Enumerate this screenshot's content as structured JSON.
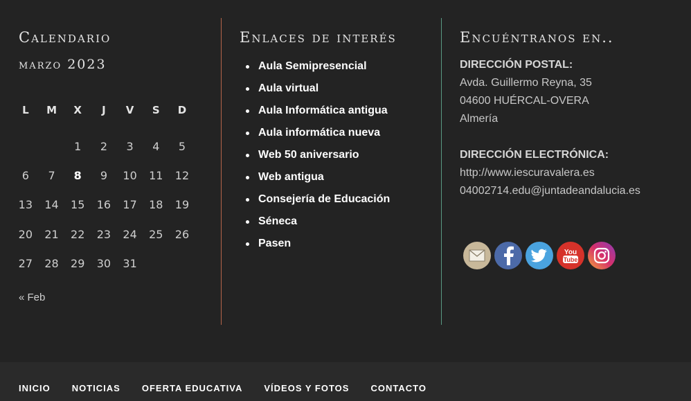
{
  "calendar": {
    "title": "Calendario",
    "month_caption": "marzo 2023",
    "weekdays": [
      "L",
      "M",
      "X",
      "J",
      "V",
      "S",
      "D"
    ],
    "weeks": [
      [
        "",
        "",
        "1",
        "2",
        "3",
        "4",
        "5"
      ],
      [
        "6",
        "7",
        "8",
        "9",
        "10",
        "11",
        "12"
      ],
      [
        "13",
        "14",
        "15",
        "16",
        "17",
        "18",
        "19"
      ],
      [
        "20",
        "21",
        "22",
        "23",
        "24",
        "25",
        "26"
      ],
      [
        "27",
        "28",
        "29",
        "30",
        "31",
        "",
        ""
      ]
    ],
    "today": "8",
    "prev_label": "« Feb"
  },
  "links": {
    "title": "Enlaces de interés",
    "items": [
      "Aula Semipresencial",
      "Aula virtual",
      "Aula Informática antigua",
      "Aula informática nueva",
      "Web 50 aniversario",
      "Web antigua",
      "Consejería de Educación",
      "Séneca",
      "Pasen"
    ]
  },
  "contact": {
    "title": "Encuéntranos en..",
    "postal_label": "DIRECCIÓN POSTAL:",
    "postal_lines": [
      "Avda. Guillermo Reyna, 35",
      "04600 HUÉRCAL-OVERA",
      "Almería"
    ],
    "electronic_label": "DIRECCIÓN ELECTRÓNICA:",
    "electronic_lines": [
      "http://www.iescuravalera.es",
      "04002714.edu@juntadeandalucia.es"
    ],
    "social": [
      {
        "name": "email",
        "icon": "envelope-icon",
        "color": "#c8b89a"
      },
      {
        "name": "facebook",
        "icon": "facebook-icon",
        "color": "#4c6aa8"
      },
      {
        "name": "twitter",
        "icon": "twitter-icon",
        "color": "#4aa3df"
      },
      {
        "name": "youtube",
        "icon": "youtube-icon",
        "color": "#d6322a"
      },
      {
        "name": "instagram",
        "icon": "instagram-icon",
        "color": "#c23d8a"
      }
    ]
  },
  "bottom_nav": [
    "INICIO",
    "NOTICIAS",
    "OFERTA EDUCATIVA",
    "VÍDEOS Y FOTOS",
    "CONTACTO"
  ],
  "colors": {
    "background": "#232323",
    "bottom_bar": "#2a2a2a",
    "divider_left": "#b5654a",
    "divider_right": "#5a9a84"
  }
}
